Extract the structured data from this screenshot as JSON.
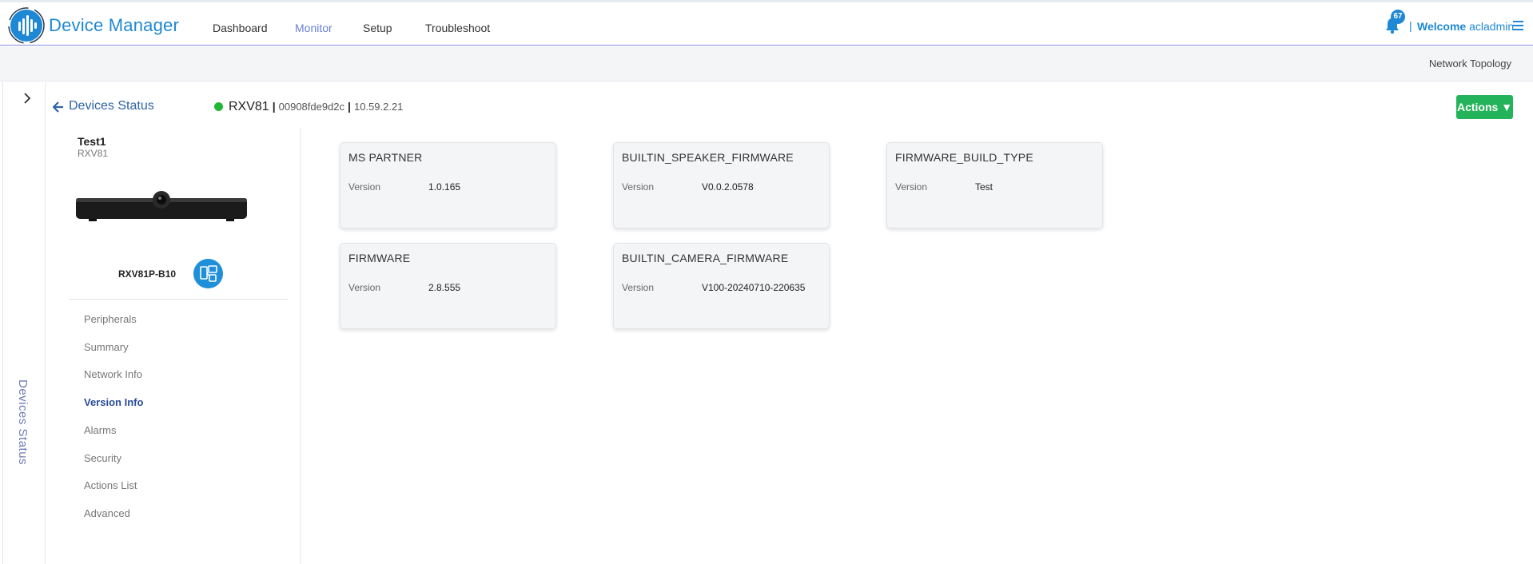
{
  "app": {
    "title": "Device Manager",
    "accent": "#1e88d4"
  },
  "nav": {
    "items": [
      {
        "label": "Dashboard",
        "active": false
      },
      {
        "label": "Monitor",
        "active": true
      },
      {
        "label": "Setup",
        "active": false
      },
      {
        "label": "Troubleshoot",
        "active": false
      }
    ]
  },
  "user": {
    "notifications": "67",
    "welcome": "Welcome",
    "name": "acladmin"
  },
  "subbar": {
    "topology": "Network Topology"
  },
  "rail": {
    "label": "Devices Status"
  },
  "page": {
    "back_label": "Devices Status",
    "status_color": "#1fb836",
    "device_model": "RXV81",
    "device_mac": "00908fde9d2c",
    "device_ip": "10.59.2.21",
    "actions_label": "Actions"
  },
  "device": {
    "name": "Test1",
    "model": "RXV81",
    "sku": "RXV81P-B10"
  },
  "side_menu": [
    {
      "label": "Peripherals",
      "active": false
    },
    {
      "label": "Summary",
      "active": false
    },
    {
      "label": "Network Info",
      "active": false
    },
    {
      "label": "Version Info",
      "active": true
    },
    {
      "label": "Alarms",
      "active": false
    },
    {
      "label": "Security",
      "active": false
    },
    {
      "label": "Actions List",
      "active": false
    },
    {
      "label": "Advanced",
      "active": false
    }
  ],
  "version_cards": [
    {
      "title": "MS PARTNER",
      "key": "Version",
      "value": "1.0.165"
    },
    {
      "title": "BUILTIN_SPEAKER_FIRMWARE",
      "key": "Version",
      "value": "V0.0.2.0578"
    },
    {
      "title": "FIRMWARE_BUILD_TYPE",
      "key": "Version",
      "value": "Test"
    },
    {
      "title": "FIRMWARE",
      "key": "Version",
      "value": "2.8.555"
    },
    {
      "title": "BUILTIN_CAMERA_FIRMWARE",
      "key": "Version",
      "value": "V100-20240710-220635"
    }
  ]
}
